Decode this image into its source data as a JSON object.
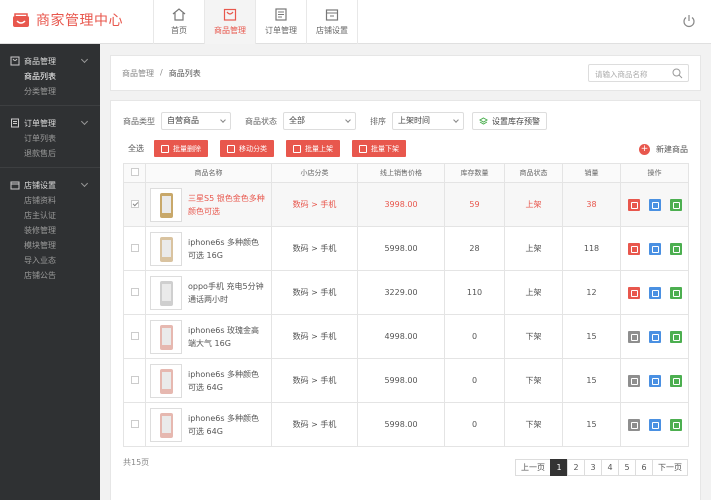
{
  "app": {
    "title": "商家管理中心"
  },
  "topnav": [
    {
      "label": "首页",
      "icon": "home-icon"
    },
    {
      "label": "商品管理",
      "icon": "bag-icon"
    },
    {
      "label": "订单管理",
      "icon": "list-icon"
    },
    {
      "label": "店铺设置",
      "icon": "store-icon"
    }
  ],
  "sidebar": {
    "groups": [
      {
        "title": "商品管理",
        "icon": "box-icon",
        "items": [
          "商品列表",
          "分类管理"
        ]
      },
      {
        "title": "订单管理",
        "icon": "order-icon",
        "items": [
          "订单列表",
          "退款售后"
        ]
      },
      {
        "title": "店铺设置",
        "icon": "shop-icon",
        "items": [
          "店铺资料",
          "店主认证",
          "装修管理",
          "模块管理",
          "导入业态",
          "店铺公告"
        ]
      }
    ]
  },
  "breadcrumb": {
    "root": "商品管理",
    "sep": "/",
    "current": "商品列表"
  },
  "search": {
    "placeholder": "请输入商品名称"
  },
  "filters": {
    "type_label": "商品类型",
    "type_value": "自营商品",
    "status_label": "商品状态",
    "status_value": "全部",
    "sort_label": "排序",
    "sort_value": "上架时间",
    "stock_button": "设置库存预警"
  },
  "actions": {
    "select_all": "全选",
    "bulk_delete": "批量删除",
    "move_category": "移动分类",
    "bulk_on": "批量上架",
    "bulk_off": "批量下架",
    "new_product": "新建商品"
  },
  "table": {
    "headers": [
      "",
      "商品名称",
      "小店分类",
      "线上销售价格",
      "库存数量",
      "商品状态",
      "销量",
      "操作"
    ],
    "rows": [
      {
        "name": "三星S5 银色金色多种颜色可选",
        "category": "数码 > 手机",
        "price": "3998.00",
        "stock": "59",
        "status": "上架",
        "sales": "38",
        "checked": true,
        "phone_color": "#c8a86a"
      },
      {
        "name": "iphone6s 多种颜色可选 16G",
        "category": "数码 > 手机",
        "price": "5998.00",
        "stock": "28",
        "status": "上架",
        "sales": "118",
        "checked": false,
        "phone_color": "#d9c3a0"
      },
      {
        "name": "oppo手机 充电5分钟通话两小时",
        "category": "数码 > 手机",
        "price": "3229.00",
        "stock": "110",
        "status": "上架",
        "sales": "12",
        "checked": false,
        "phone_color": "#cfcfcf"
      },
      {
        "name": "iphone6s 玫瑰金高端大气 16G",
        "category": "数码 > 手机",
        "price": "4998.00",
        "stock": "0",
        "status": "下架",
        "sales": "15",
        "checked": false,
        "phone_color": "#e6b8b0"
      },
      {
        "name": "iphone6s 多种颜色可选 64G",
        "category": "数码 > 手机",
        "price": "5998.00",
        "stock": "0",
        "status": "下架",
        "sales": "15",
        "checked": false,
        "phone_color": "#e6b8b0"
      },
      {
        "name": "iphone6s 多种颜色可选 64G",
        "category": "数码 > 手机",
        "price": "5998.00",
        "stock": "0",
        "status": "下架",
        "sales": "15",
        "checked": false,
        "phone_color": "#e6b8b0"
      }
    ]
  },
  "footer": {
    "total": "共15页",
    "prev": "上一页",
    "pages": [
      "1",
      "2",
      "3",
      "4",
      "5",
      "6"
    ],
    "current_page": "1",
    "next": "下一页"
  },
  "colors": {
    "accent": "#e8574d",
    "sidebar_bg": "#2f3133"
  }
}
